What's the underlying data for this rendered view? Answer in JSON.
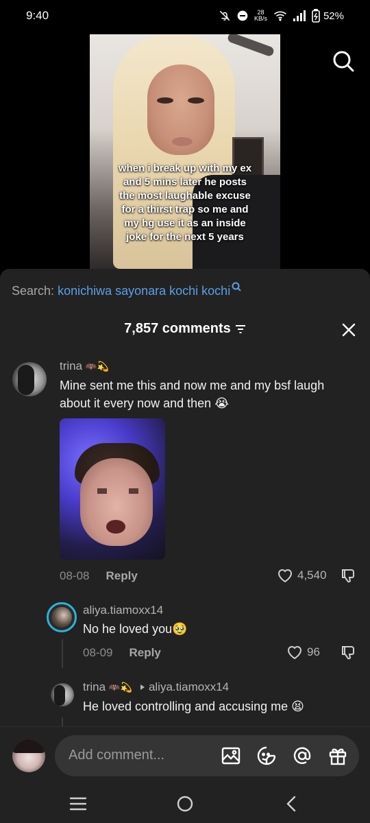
{
  "status_bar": {
    "time": "9:40",
    "net_speed_value": "28",
    "net_speed_unit": "KB/s",
    "battery": "52%"
  },
  "video": {
    "caption": "when i break up with my ex and 5 mins later he posts the most laughable excuse for a thirst trap so me and my hg use it as an inside joke for the next 5 years"
  },
  "search": {
    "prefix": "Search:",
    "query": "konichiwa sayonara kochi kochi"
  },
  "comments_header": {
    "count_label": "7,857 comments"
  },
  "comments": [
    {
      "username": "trina",
      "emojis": "🦇💫",
      "text": "Mine sent me this and now me and my bsf laugh about it every now and then 😭",
      "date": "08-08",
      "reply_label": "Reply",
      "likes": "4,540"
    },
    {
      "username": "aliya.tiamoxx14",
      "text": "No he loved you🥹",
      "date": "08-09",
      "reply_label": "Reply",
      "likes": "96"
    },
    {
      "username": "trina",
      "emojis": "🦇💫",
      "reply_to": "aliya.tiamoxx14",
      "text": "He loved controlling and accusing me 😫"
    }
  ],
  "input": {
    "placeholder": "Add comment..."
  },
  "colors": {
    "sheet_bg": "#222222",
    "search_query": "#5aa0e6",
    "input_bg": "#353535",
    "story_ring": "#2bb3d8"
  }
}
